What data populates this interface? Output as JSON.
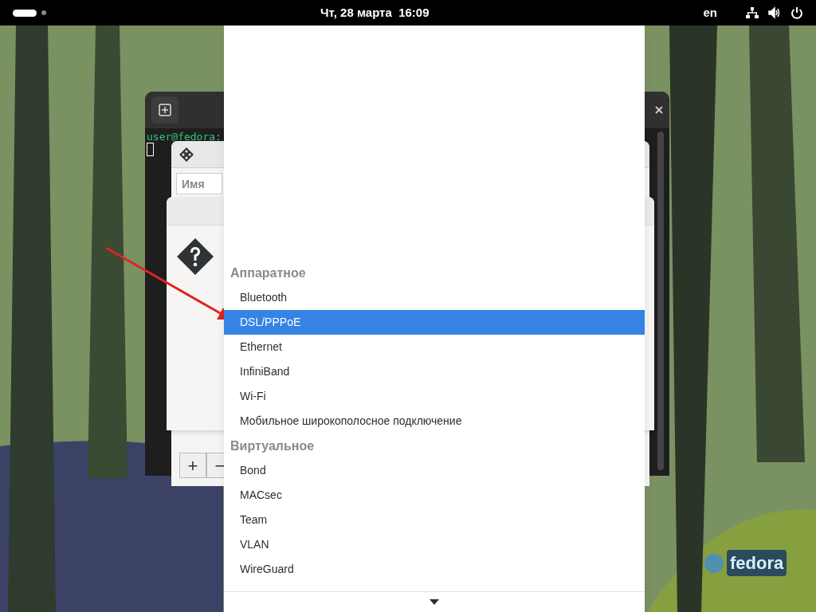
{
  "top_bar": {
    "clock": "Чт, 28 марта  16:09",
    "keyboard_layout": "en"
  },
  "terminal": {
    "prompt": "user@fedora:"
  },
  "network_window": {
    "name_field": {
      "placeholder": "Имя"
    },
    "buttons": [
      "+",
      "−"
    ]
  },
  "menu": {
    "sections": [
      {
        "title": "Аппаратное",
        "items": [
          {
            "label": "Bluetooth",
            "selected": false
          },
          {
            "label": "DSL/PPPoE",
            "selected": true
          },
          {
            "label": "Ethernet",
            "selected": false
          },
          {
            "label": "InfiniBand",
            "selected": false
          },
          {
            "label": "Wi-Fi",
            "selected": false
          },
          {
            "label": "Мобильное широкополосное подключение",
            "selected": false
          }
        ]
      },
      {
        "title": "Виртуальное",
        "items": [
          {
            "label": "Bond",
            "selected": false
          },
          {
            "label": "MACsec",
            "selected": false
          },
          {
            "label": "Team",
            "selected": false
          },
          {
            "label": "VLAN",
            "selected": false
          },
          {
            "label": "WireGuard",
            "selected": false
          }
        ]
      }
    ]
  },
  "wallpaper_logo": "fedora"
}
